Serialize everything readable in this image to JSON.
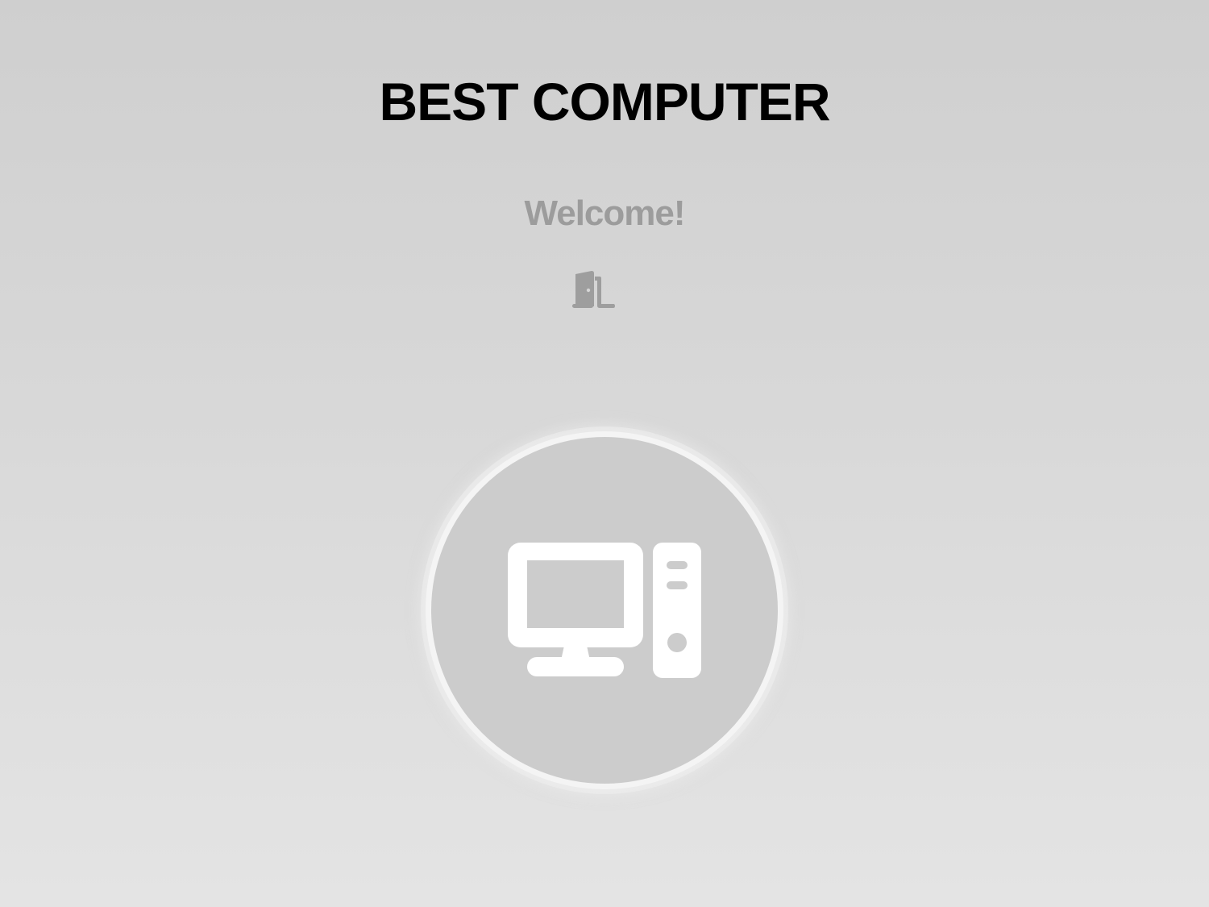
{
  "header": {
    "title": "BEST COMPUTER",
    "welcome": "Welcome!"
  },
  "actions": {
    "logout_icon": "door-exit-icon",
    "main_button_icon": "desktop-computer-icon"
  },
  "colors": {
    "title": "#000000",
    "welcome": "#9c9c9c",
    "icon_muted": "#9e9e9e",
    "button_fill": "#cccccc",
    "button_ring": "#f4f4f4",
    "icon_white": "#ffffff"
  }
}
